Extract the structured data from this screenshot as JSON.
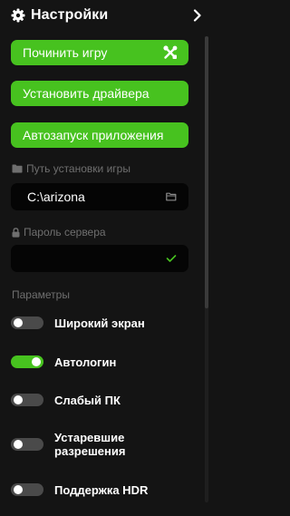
{
  "header": {
    "title": "Настройки",
    "icon": "gear-icon",
    "nav_icon": "chevron-right-icon"
  },
  "buttons": {
    "repair": "Починить игру",
    "repair_icon": "tools-icon",
    "install_drivers": "Установить драйвера",
    "autostart": "Автозапуск приложения"
  },
  "install_path": {
    "label": "Путь установки игры",
    "label_icon": "folder-icon",
    "value": "C:\\arizona",
    "button_icon": "folder-open-icon"
  },
  "server_password": {
    "label": "Пароль сервера",
    "label_icon": "lock-icon",
    "value": "",
    "confirm_icon": "check-icon"
  },
  "parameters": {
    "title": "Параметры",
    "options": [
      {
        "label": "Широкий экран",
        "enabled": false
      },
      {
        "label": "Автологин",
        "enabled": true
      },
      {
        "label": "Слабый ПК",
        "enabled": false
      },
      {
        "label": "Устаревшие разрешения",
        "enabled": false
      },
      {
        "label": "Поддержка HDR",
        "enabled": false
      }
    ]
  },
  "colors": {
    "background": "#141414",
    "accent": "#47c21f",
    "field": "#050505",
    "muted_text": "#6f6f6f",
    "toggle_off": "#4a4a4a"
  }
}
